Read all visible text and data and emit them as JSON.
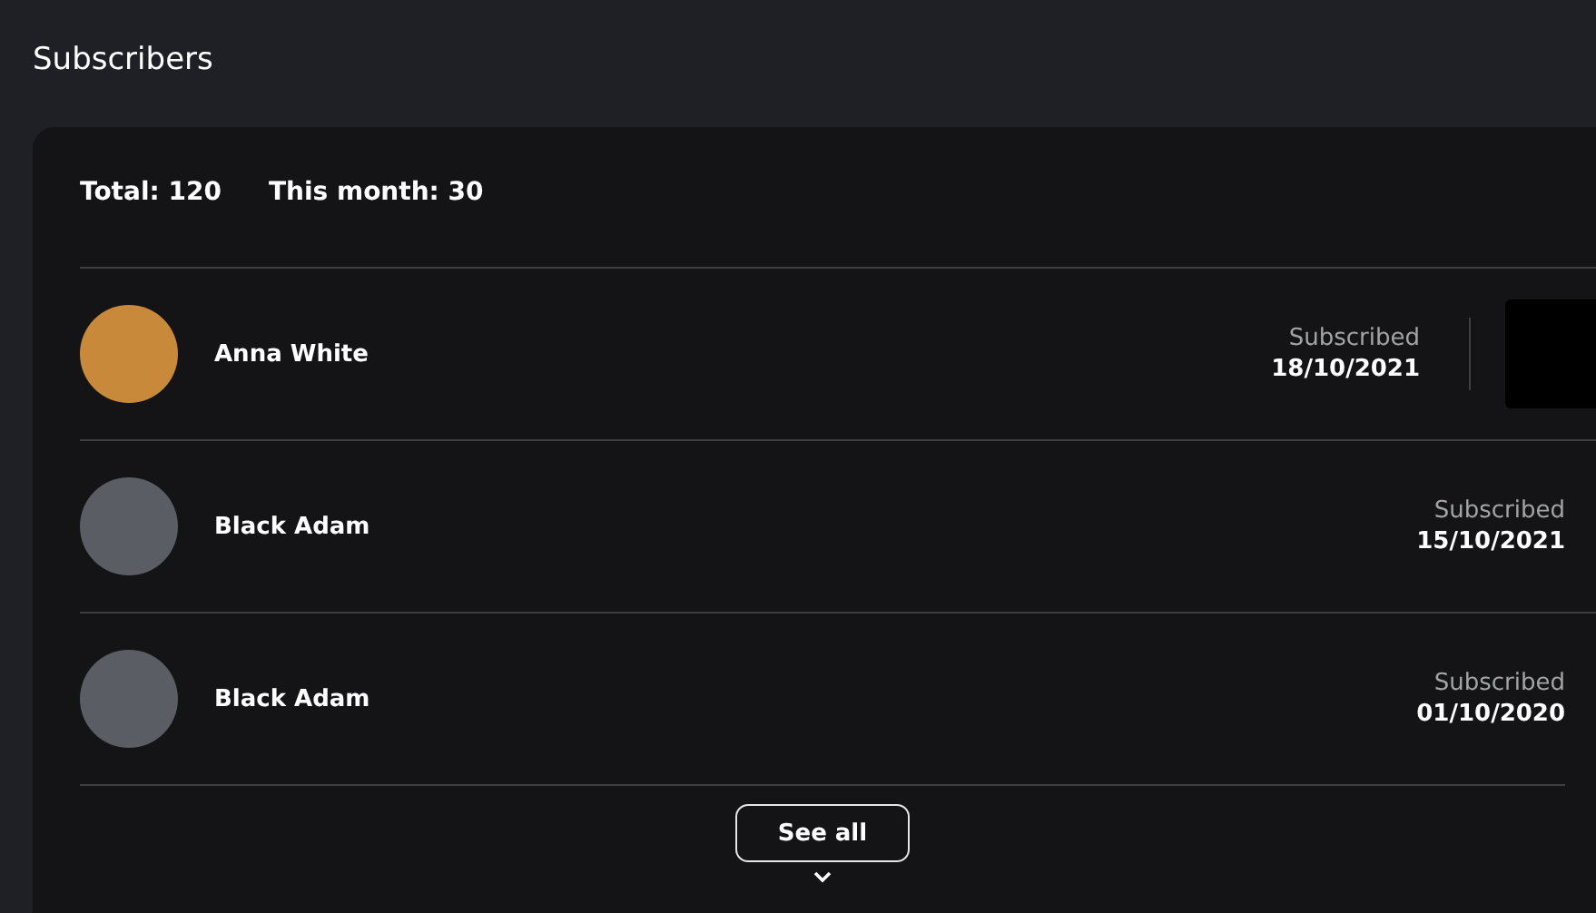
{
  "page": {
    "title": "Subscribers"
  },
  "summary": {
    "total": "Total: 120",
    "this_month": "This month: 30"
  },
  "subscribers": [
    {
      "name": "Anna White",
      "status": "Subscribed",
      "date": "18/10/2021",
      "revealed": true
    },
    {
      "name": "Black Adam",
      "status": "Subscribed",
      "date": "15/10/2021",
      "revealed": false
    },
    {
      "name": "Black Adam",
      "status": "Subscribed",
      "date": "01/10/2020",
      "revealed": false
    }
  ],
  "see_all_button": {
    "label": "See all"
  }
}
